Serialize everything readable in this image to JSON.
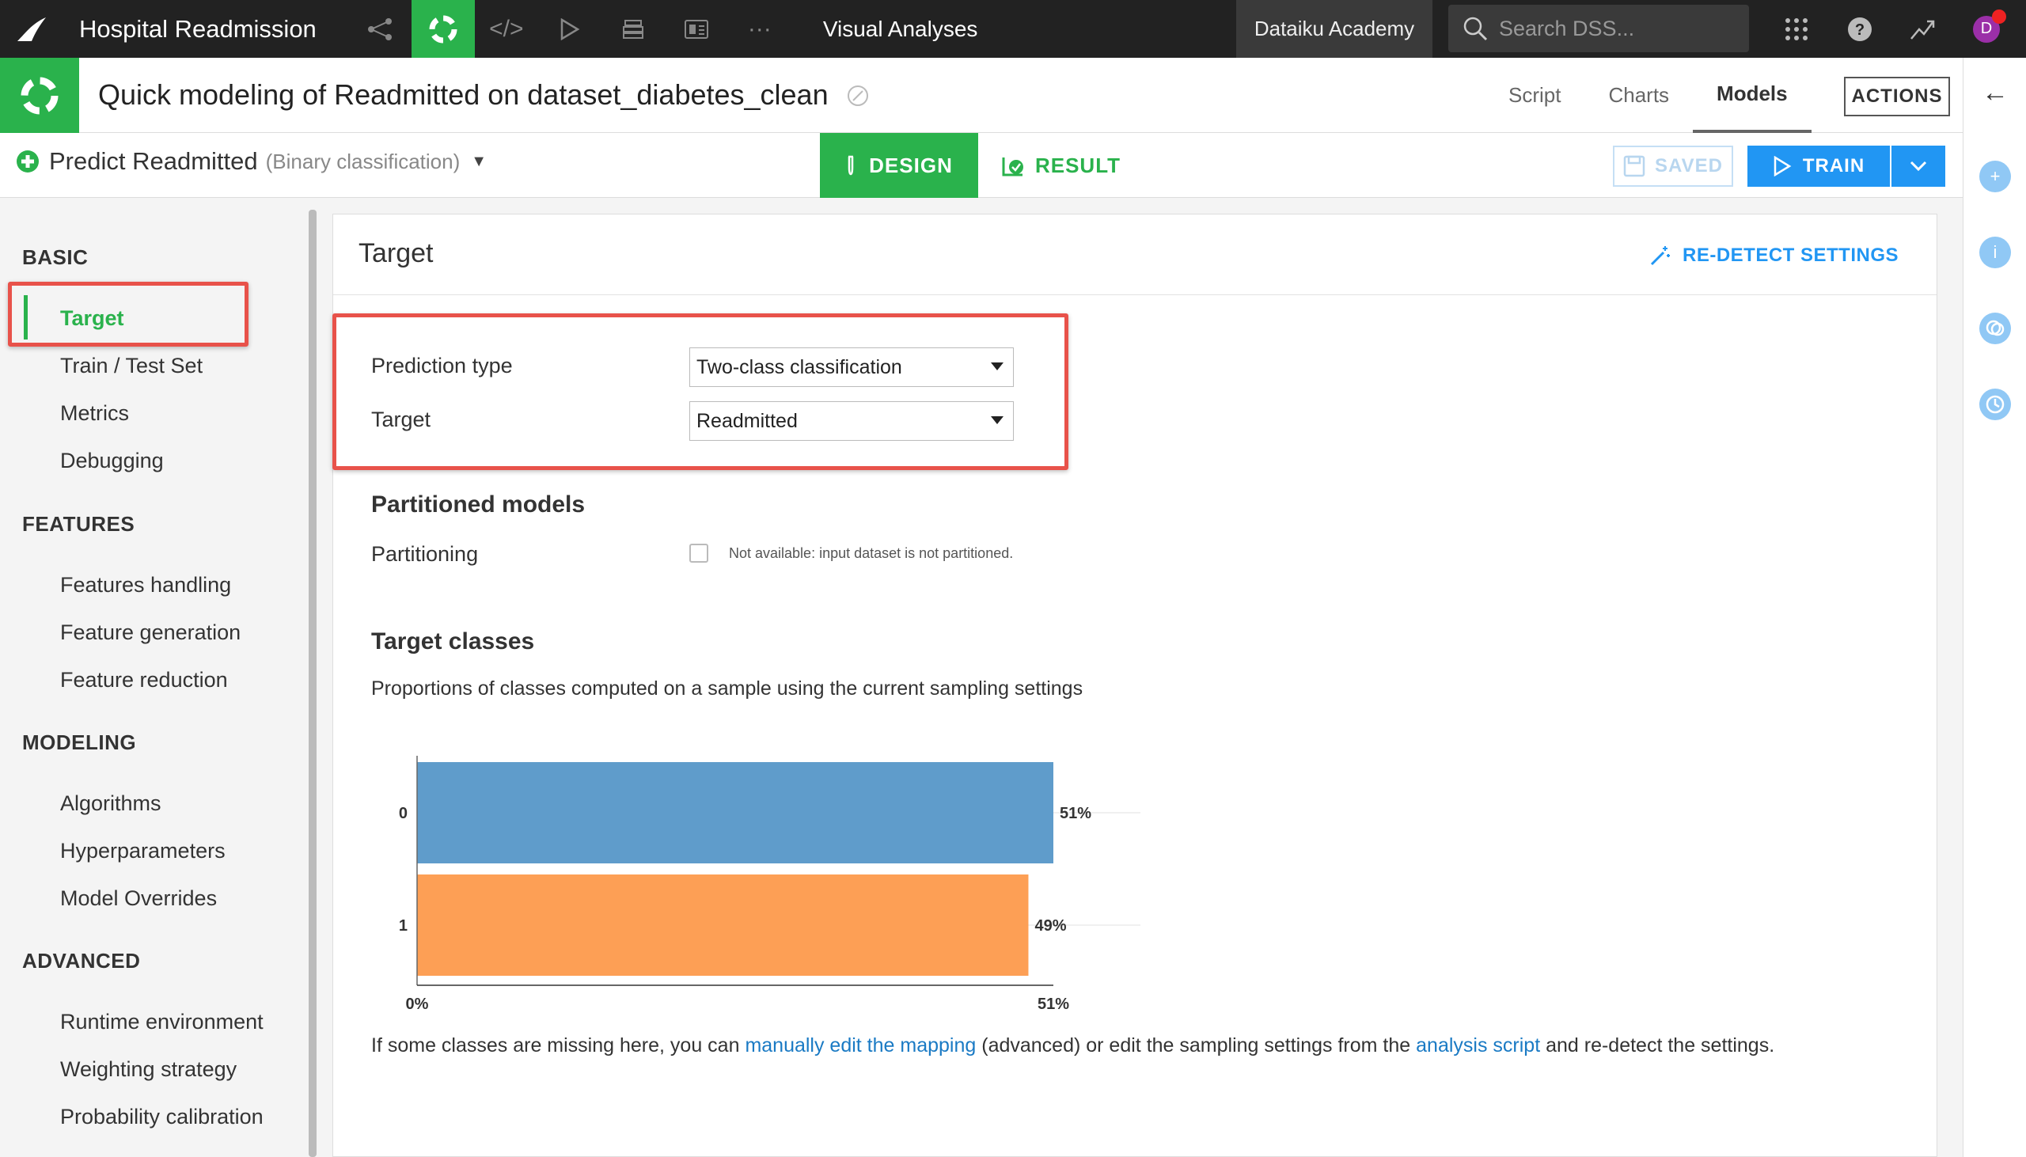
{
  "topnav": {
    "project_title": "Hospital Readmission",
    "section": "Visual Analyses",
    "instance": "Dataiku Academy",
    "search_placeholder": "Search DSS...",
    "avatar_initial": "D",
    "icons": [
      "flow-icon",
      "lab-icon",
      "code-icon",
      "run-icon",
      "datasets-icon",
      "dashboard-icon",
      "more-icon"
    ]
  },
  "header": {
    "title": "Quick modeling of Readmitted on dataset_diabetes_clean",
    "tabs": [
      {
        "label": "Script"
      },
      {
        "label": "Charts"
      },
      {
        "label": "Models"
      }
    ],
    "active_tab": "Models",
    "actions_label": "ACTIONS"
  },
  "subheader": {
    "model_name": "Predict Readmitted",
    "model_type": "(Binary classification)",
    "design_label": "DESIGN",
    "result_label": "RESULT",
    "saved_label": "SAVED",
    "train_label": "TRAIN"
  },
  "sidebar": {
    "sections": [
      {
        "title": "BASIC",
        "items": [
          "Target",
          "Train / Test Set",
          "Metrics",
          "Debugging"
        ]
      },
      {
        "title": "FEATURES",
        "items": [
          "Features handling",
          "Feature generation",
          "Feature reduction"
        ]
      },
      {
        "title": "MODELING",
        "items": [
          "Algorithms",
          "Hyperparameters",
          "Model Overrides"
        ]
      },
      {
        "title": "ADVANCED",
        "items": [
          "Runtime environment",
          "Weighting strategy",
          "Probability calibration"
        ]
      }
    ],
    "active_item": "Target"
  },
  "panel": {
    "title": "Target",
    "redetect_label": "RE-DETECT SETTINGS",
    "prediction_type_label": "Prediction type",
    "prediction_type_value": "Two-class classification",
    "target_label": "Target",
    "target_value": "Readmitted",
    "partitioned_title": "Partitioned models",
    "partitioning_label": "Partitioning",
    "partitioning_note": "Not available: input dataset is not partitioned.",
    "target_classes_title": "Target classes",
    "target_classes_desc": "Proportions of classes computed on a sample using the current sampling settings",
    "footer_prefix": "If some classes are missing here, you can ",
    "footer_link1": "manually edit the mapping",
    "footer_middle": " (advanced) or edit the sampling settings from the ",
    "footer_link2": "analysis script",
    "footer_suffix": " and re-detect the settings."
  },
  "chart_data": {
    "type": "bar",
    "orientation": "horizontal",
    "categories": [
      "0",
      "1"
    ],
    "values": [
      51,
      49
    ],
    "data_labels": [
      "51%",
      "49%"
    ],
    "colors": [
      "#5f9ccb",
      "#fd9f55"
    ],
    "xlim": [
      0,
      51
    ],
    "x_ticks": [
      "0%",
      "51%"
    ],
    "title": "",
    "xlabel": "",
    "ylabel": ""
  },
  "colors": {
    "accent_green": "#2ab24c",
    "primary_blue": "#2196f3",
    "highlight_red": "#e8524a"
  }
}
